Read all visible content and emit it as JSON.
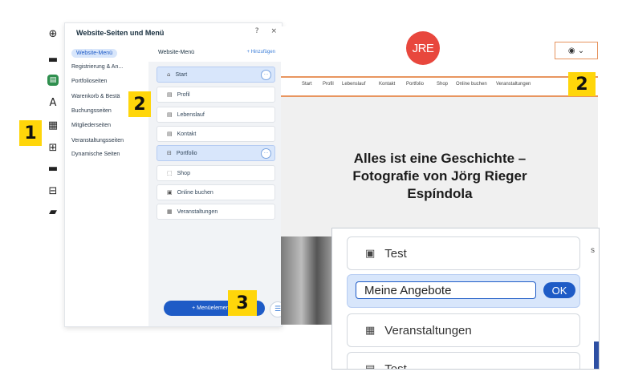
{
  "rail": {
    "icons": [
      "add-icon",
      "menu-icon",
      "pages-icon",
      "design-icon",
      "apps-icon",
      "business-icon",
      "media-icon",
      "table-icon",
      "portfolio-icon"
    ]
  },
  "panel": {
    "title": "Website-Seiten und Menü",
    "help": "?",
    "close": "×",
    "left_items": [
      "Website-Menü",
      "Registrierung & An...",
      "Portfolioseiten",
      "Warenkorb & Bestä",
      "Buchungsseiten",
      "Mitgliederseiten",
      "Veranstaltungsseiten",
      "Dynamische Seiten"
    ],
    "menu_header": "Website-Menü",
    "add_link": "+ Hinzufügen",
    "menu_items": [
      {
        "label": "Start",
        "icon": "⌂"
      },
      {
        "label": "Profil",
        "icon": "▤"
      },
      {
        "label": "Lebenslauf",
        "icon": "▤"
      },
      {
        "label": "Kontakt",
        "icon": "▤"
      },
      {
        "label": "Portfolio",
        "icon": "⊟"
      },
      {
        "label": "Shop",
        "icon": "⬚"
      },
      {
        "label": "Online buchen",
        "icon": "▣"
      },
      {
        "label": "Veranstaltungen",
        "icon": "▦"
      }
    ],
    "add_button": "+ Menüelement hi",
    "more_symbol": "···"
  },
  "site": {
    "logo": "JRE",
    "nav": [
      "Start",
      "Profil",
      "Lebenslauf",
      "Kontakt",
      "Portfolio",
      "Shop",
      "Online buchen",
      "Veranstaltungen"
    ],
    "headline_1": "Alles ist eine Geschichte –",
    "headline_2": "Fotografie von Jörg Rieger",
    "headline_3": "Espíndola"
  },
  "inset": {
    "item_test": "Test",
    "edit_value": "Meine Angebote",
    "ok_label": "OK",
    "item_events": "Veranstaltungen",
    "item_cut": "Test",
    "edge_letter": "s"
  },
  "badges": [
    "1",
    "2",
    "2",
    "3"
  ],
  "colors": {
    "accent_blue": "#1e5bc6",
    "badge_yellow": "#ffd60a",
    "logo_red": "#e8473d",
    "nav_border_orange": "#e8955f"
  }
}
